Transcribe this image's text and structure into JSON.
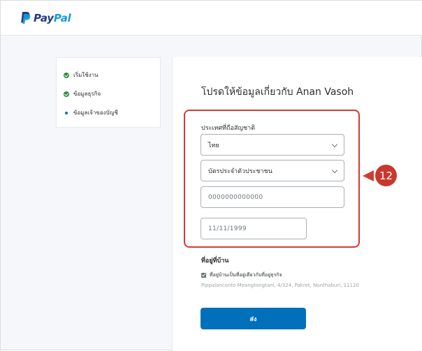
{
  "brand": {
    "pay": "Pay",
    "pal": "Pal"
  },
  "steps": [
    {
      "label": "เริ่มใช้งาน",
      "state": "done"
    },
    {
      "label": "ข้อมูลธุรกิจ",
      "state": "done"
    },
    {
      "label": "ข้อมูลเจ้าของบัญชี",
      "state": "current"
    }
  ],
  "form": {
    "title": "โปรดให้ข้อมูลเกี่ยวกับ Anan Vasoh",
    "nationality_label": "ประเทศที่ถือสัญชาติ",
    "country_value": "ไทย",
    "id_type_value": "บัตรประจำตัวประชาชน",
    "id_number_value": "0000000000000",
    "dob_value": "11/11/1999",
    "home_address_label": "ที่อยู่ที่บ้าน",
    "same_address_label": "ที่อยู่บ้านเป็นที่อยู่เดียวกับที่อยู่ธุรกิจ",
    "address_text": "Pippalanconto Meangtongtani, 4/324, Pakret, Nonthaburi, 11120",
    "submit_label": "ส่ง"
  },
  "callout": {
    "number": "12"
  },
  "colors": {
    "accent": "#0070ba",
    "highlight": "#d13b35",
    "success": "#2a8a3e"
  }
}
